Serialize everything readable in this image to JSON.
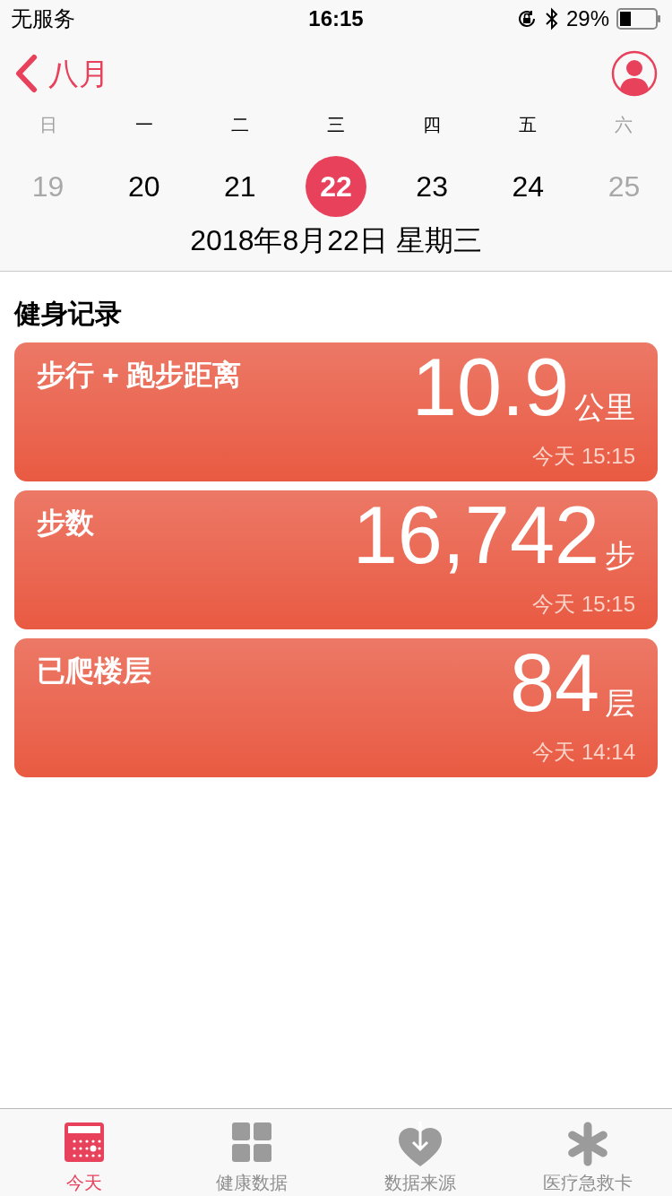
{
  "status_bar": {
    "carrier": "无服务",
    "time": "16:15",
    "battery_text": "29%"
  },
  "nav": {
    "back_label": "八月"
  },
  "week": {
    "weekdays": [
      {
        "label": "日",
        "dimmed": true
      },
      {
        "label": "一",
        "dimmed": false
      },
      {
        "label": "二",
        "dimmed": false
      },
      {
        "label": "三",
        "dimmed": false
      },
      {
        "label": "四",
        "dimmed": false
      },
      {
        "label": "五",
        "dimmed": false
      },
      {
        "label": "六",
        "dimmed": true
      }
    ],
    "days": [
      {
        "label": "19",
        "dimmed": true,
        "selected": false
      },
      {
        "label": "20",
        "dimmed": false,
        "selected": false
      },
      {
        "label": "21",
        "dimmed": false,
        "selected": false
      },
      {
        "label": "22",
        "dimmed": false,
        "selected": true
      },
      {
        "label": "23",
        "dimmed": false,
        "selected": false
      },
      {
        "label": "24",
        "dimmed": false,
        "selected": false
      },
      {
        "label": "25",
        "dimmed": true,
        "selected": false
      }
    ],
    "date_line": "2018年8月22日 星期三"
  },
  "section_title": "健身记录",
  "cards": [
    {
      "title": "步行 + 跑步距离",
      "value": "10.9",
      "unit": "公里",
      "time": "今天 15:15"
    },
    {
      "title": "步数",
      "value": "16,742",
      "unit": "步",
      "time": "今天 15:15"
    },
    {
      "title": "已爬楼层",
      "value": "84",
      "unit": "层",
      "time": "今天 14:14"
    }
  ],
  "tabs": [
    {
      "kind": "today",
      "label": "今天",
      "selected": true
    },
    {
      "kind": "data",
      "label": "健康数据",
      "selected": false
    },
    {
      "kind": "sources",
      "label": "数据来源",
      "selected": false
    },
    {
      "kind": "medical",
      "label": "医疗急救卡",
      "selected": false
    }
  ]
}
